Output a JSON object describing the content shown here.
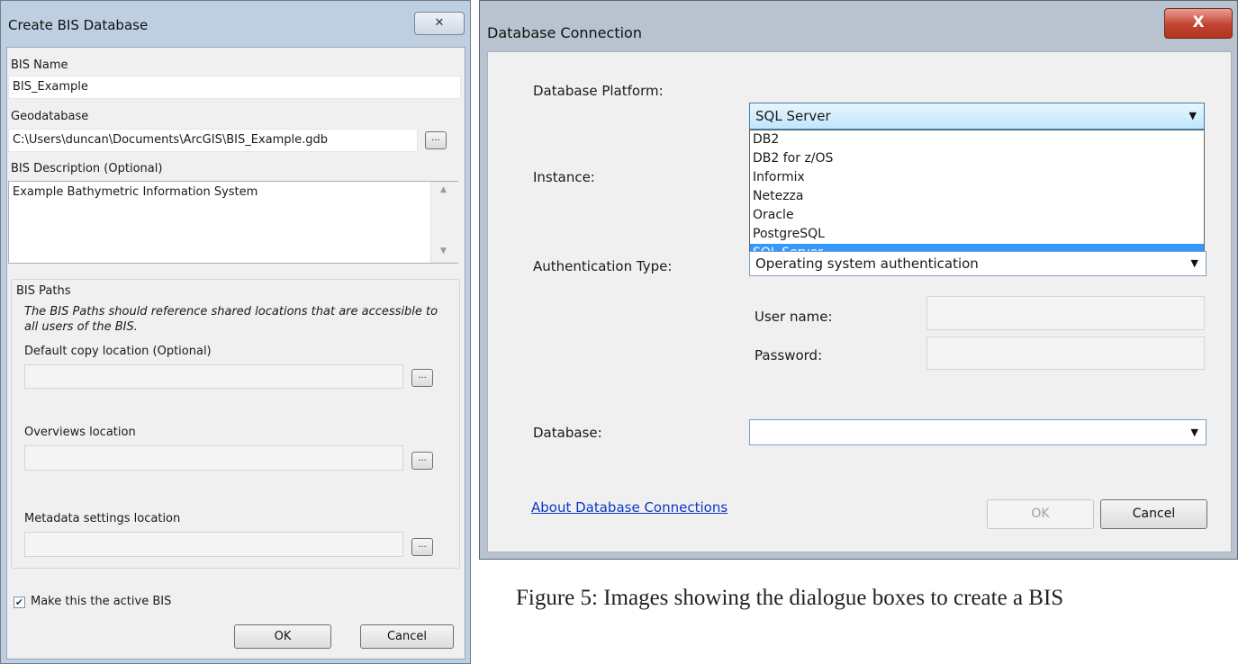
{
  "create_bis": {
    "title": "Create BIS Database",
    "close_glyph": "✕",
    "bis_name_label": "BIS Name",
    "bis_name_value": "BIS_Example",
    "geodatabase_label": "Geodatabase",
    "geodatabase_value": "C:\\Users\\duncan\\Documents\\ArcGIS\\BIS_Example.gdb",
    "browse_glyph": "...",
    "description_label": "BIS Description (Optional)",
    "description_value": "Example Bathymetric Information System",
    "paths_group_label": "BIS Paths",
    "paths_note": "The BIS Paths should reference shared locations that are accessible to all users of the BIS.",
    "default_copy_label": "Default copy location (Optional)",
    "default_copy_value": "",
    "overviews_label": "Overviews location",
    "overviews_value": "",
    "metadata_label": "Metadata settings location",
    "metadata_value": "",
    "active_checkbox_label": "Make this the active BIS",
    "active_checked": true,
    "ok_label": "OK",
    "cancel_label": "Cancel"
  },
  "db_connection": {
    "title": "Database Connection",
    "close_glyph": "X",
    "platform_label": "Database Platform:",
    "platform_selected": "SQL Server",
    "platform_options": [
      "DB2",
      "DB2 for z/OS",
      "Informix",
      "Netezza",
      "Oracle",
      "PostgreSQL",
      "SQL Server"
    ],
    "instance_label": "Instance:",
    "auth_type_label": "Authentication Type:",
    "auth_type_value": "Operating system authentication",
    "user_name_label": "User name:",
    "password_label": "Password:",
    "database_label": "Database:",
    "database_value": "",
    "about_link": "About Database Connections",
    "ok_label": "OK",
    "cancel_label": "Cancel"
  },
  "caption": "Figure 5: Images showing the dialogue boxes to create a BIS",
  "colors": {
    "selection": "#3399ff",
    "close_red": "#c2432f",
    "link": "#0b38c6"
  }
}
